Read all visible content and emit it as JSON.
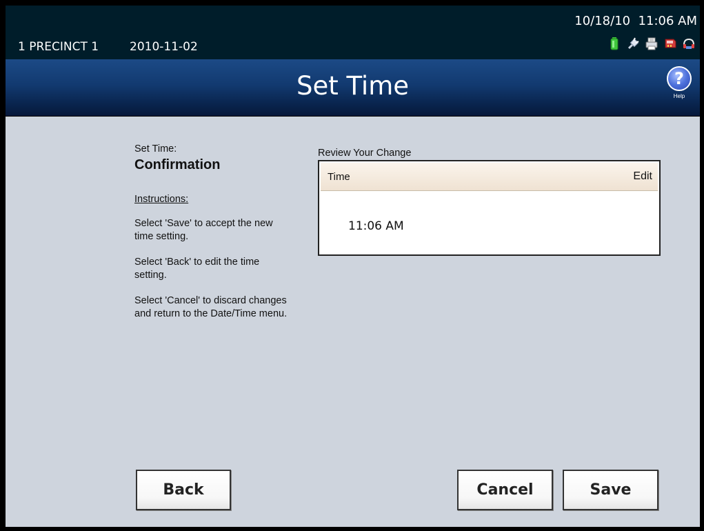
{
  "status": {
    "precinct": "1 PRECINCT 1",
    "election_date": "2010-11-02",
    "datetime": "10/18/10  11:06 AM",
    "icons": [
      "battery-icon",
      "power-plug-icon",
      "printer-icon",
      "memory-card-icon",
      "audio-icon"
    ]
  },
  "header": {
    "title": "Set Time",
    "help_label": "Help"
  },
  "instructions": {
    "step_label": "Set Time:",
    "step_title": "Confirmation",
    "heading": "Instructions:",
    "save_text": "Select 'Save' to accept the new time setting.",
    "back_text": "Select 'Back' to edit the time setting.",
    "cancel_text": "Select 'Cancel' to discard changes and return to the Date/Time menu."
  },
  "review": {
    "label": "Review Your Change",
    "column_time": "Time",
    "column_edit": "Edit",
    "time_value": "11:06 AM"
  },
  "buttons": {
    "back": "Back",
    "cancel": "Cancel",
    "save": "Save"
  },
  "colors": {
    "background": "#ced4dd",
    "status_bar": "#001d2a",
    "title_bar": "#123a70",
    "battery": "#3fc63c"
  }
}
